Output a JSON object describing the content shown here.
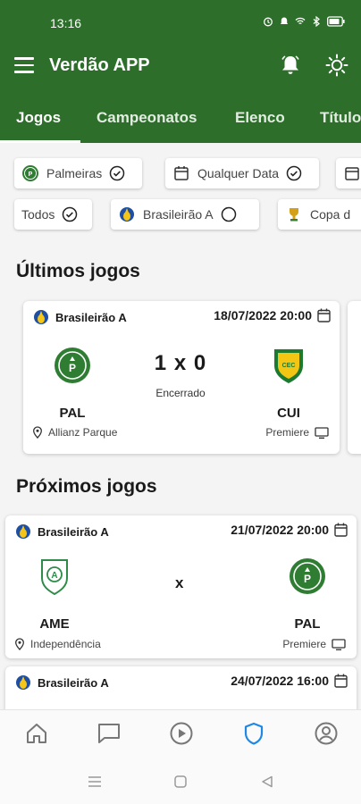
{
  "status_bar": {
    "time": "13:16"
  },
  "app_bar": {
    "title": "Verdão APP"
  },
  "tabs": [
    {
      "label": "Jogos",
      "active": true
    },
    {
      "label": "Campeonatos",
      "active": false
    },
    {
      "label": "Elenco",
      "active": false
    },
    {
      "label": "Título",
      "active": false
    }
  ],
  "filters": {
    "row1": [
      {
        "label": "Palmeiras",
        "icon": "palmeiras-crest-icon",
        "checked": true
      },
      {
        "label": "Qualquer Data",
        "icon": "calendar-icon",
        "checked": true
      }
    ],
    "row2": [
      {
        "label": "Todos",
        "checked": true
      },
      {
        "label": "Brasileirão A",
        "icon": "brasileirao-logo-icon",
        "checked": false
      },
      {
        "label": "Copa d",
        "icon": "copa-trophy-icon"
      }
    ]
  },
  "sections": {
    "last_games": "Últimos jogos",
    "next_games": "Próximos jogos"
  },
  "last_game": {
    "competition": "Brasileirão A",
    "datetime": "18/07/2022 20:00",
    "home": "PAL",
    "away": "CUI",
    "score": "1 x 0",
    "status": "Encerrado",
    "venue": "Allianz Parque",
    "broadcast": "Premiere"
  },
  "next_games": [
    {
      "competition": "Brasileirão A",
      "datetime": "21/07/2022 20:00",
      "home": "AME",
      "away": "PAL",
      "separator": "x",
      "venue": "Independência",
      "broadcast": "Premiere"
    },
    {
      "competition": "Brasileirão A",
      "datetime": "24/07/2022 16:00"
    }
  ],
  "colors": {
    "primary": "#2c6e2a",
    "nav_active": "#1e88e5"
  }
}
